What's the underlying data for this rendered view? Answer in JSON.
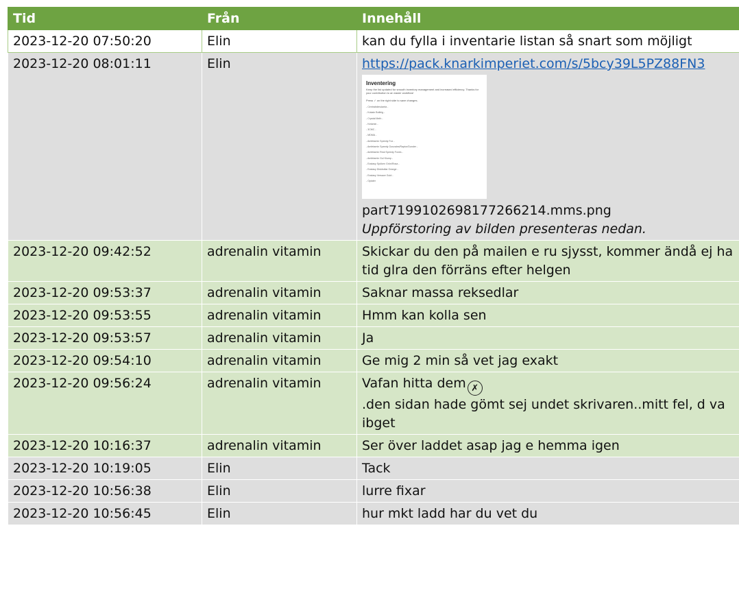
{
  "headers": {
    "tid": "Tid",
    "fran": "Från",
    "innehall": "Innehåll"
  },
  "messages": [
    {
      "time": "2023-12-20 07:50:20",
      "from": "Elin",
      "text": "kan du fylla i inventarie listan så snart som möjligt"
    },
    {
      "time": "2023-12-20 08:01:11",
      "from": "Elin",
      "link": "https://pack.knarkimperiet.com/s/5bcy39L5PZ88FN3",
      "attachment": {
        "title": "Inventering",
        "description": "Keep the list updated for smooth inventory management and increased efficiency. Thanks for your contribution to an easier workflow!",
        "instruction": "Press ✓ on the right side to save changes.",
        "items": [
          "- Centralstimulanta -",
          "- Kokain Bolibig -",
          "- Crystal Meth -",
          "- Ketamin -",
          "- 3CMC -",
          "- MDMA -",
          "- Amfetamin Speedy Fox -",
          "- Amfetamin Speedy Gonzales/Raptor/Dunder -",
          "- Amfetamin Real Speedy Foxes -",
          "- Amfetamin Gul Klump -",
          "- Ecstasy Spöken Grön/Rosa -",
          "- Ecstasy Diskbollar Orange -",
          "- Ecstasy Versace Guld -",
          "- Opiater"
        ],
        "filename": "part7199102698177266214.mms.png",
        "caption": "Uppförstoring av bilden presenteras nedan."
      }
    },
    {
      "time": "2023-12-20 09:42:52",
      "from": "adrenalin vitamin",
      "text": "Skickar du den på mailen e ru sjysst, kommer ändå ej ha tid glra den förräns efter helgen"
    },
    {
      "time": "2023-12-20 09:53:37",
      "from": "adrenalin vitamin",
      "text": "Saknar massa reksedlar"
    },
    {
      "time": "2023-12-20 09:53:55",
      "from": "adrenalin vitamin",
      "text": "Hmm kan kolla sen"
    },
    {
      "time": "2023-12-20 09:53:57",
      "from": "adrenalin vitamin",
      "text": "Ja"
    },
    {
      "time": "2023-12-20 09:54:10",
      "from": "adrenalin vitamin",
      "text": "Ge mig 2 min så vet jag exakt"
    },
    {
      "time": "2023-12-20 09:56:24",
      "from": "adrenalin vitamin",
      "text": "Vafan hitta dem",
      "emoji": "face-with-crossed-out-eyes-icon",
      "text2": ".den sidan hade gömt sej undet skrivaren..mitt fel, d va ibget"
    },
    {
      "time": "2023-12-20 10:16:37",
      "from": "adrenalin vitamin",
      "text": "Ser över laddet asap jag e hemma igen"
    },
    {
      "time": "2023-12-20 10:19:05",
      "from": "Elin",
      "text": "Tack"
    },
    {
      "time": "2023-12-20 10:56:38",
      "from": "Elin",
      "text": "lurre fixar"
    },
    {
      "time": "2023-12-20 10:56:45",
      "from": "Elin",
      "text": "hur mkt ladd har du vet du"
    }
  ],
  "colors": {
    "header": "#6ea342",
    "elin_row": "#dedede",
    "other_row": "#d6e6c7",
    "link": "#1a5fb4"
  }
}
